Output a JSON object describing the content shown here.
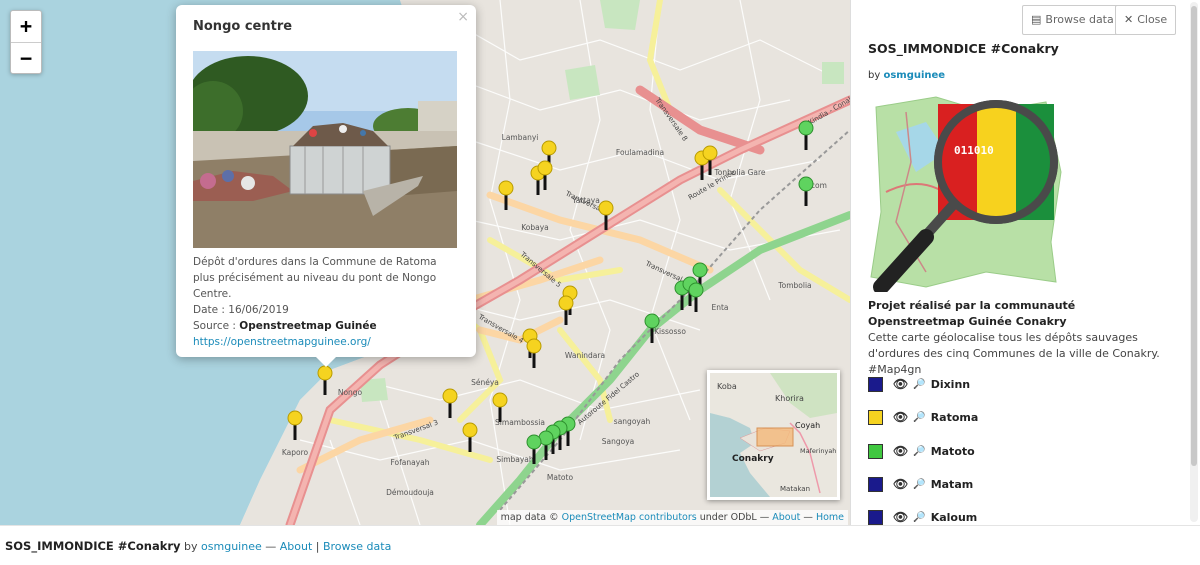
{
  "map": {
    "zoom_in": "+",
    "zoom_out": "−",
    "place_labels": [
      {
        "text": "Foulamadina"
      },
      {
        "text": "Yattaya"
      },
      {
        "text": "Kobaya"
      },
      {
        "text": "Tonbolia Gare"
      },
      {
        "text": "Tombolia"
      },
      {
        "text": "Cocom"
      },
      {
        "text": "Kissosso"
      },
      {
        "text": "Enta"
      },
      {
        "text": "Wanindara"
      },
      {
        "text": "Sénéya"
      },
      {
        "text": "Simbayah"
      },
      {
        "text": "Nongo"
      },
      {
        "text": "Simambossia"
      },
      {
        "text": "sangoyah"
      },
      {
        "text": "Sangoya"
      },
      {
        "text": "Kaporo"
      },
      {
        "text": "Fofanayah"
      },
      {
        "text": "Démoudouja"
      },
      {
        "text": "Matoto"
      },
      {
        "text": "Lambanyi"
      }
    ],
    "road_labels": [
      {
        "text": "Transversale 8"
      },
      {
        "text": "Transversale 7"
      },
      {
        "text": "Transversale 5"
      },
      {
        "text": "Transversale 4"
      },
      {
        "text": "Transversal 3"
      },
      {
        "text": "Autoroute Fidel Castro"
      },
      {
        "text": "Route le Prince"
      },
      {
        "text": "Kindia - Conakry"
      },
      {
        "text": "Transversal 6"
      }
    ],
    "minimap_labels": [
      {
        "text": "Koba"
      },
      {
        "text": "Khorira"
      },
      {
        "text": "Coyah"
      },
      {
        "text": "Conakry"
      },
      {
        "text": "Maferinyah"
      },
      {
        "text": "Matakan"
      }
    ],
    "attribution": {
      "prefix": "map data ©",
      "osm": "OpenStreetMap contributors",
      "license": "under ODbL",
      "sep1": "—",
      "about": "About",
      "sep2": "—",
      "home": "Home"
    },
    "colors": {
      "ratoma": "#f5d320",
      "matoto": "#5fd35f"
    }
  },
  "popup": {
    "close": "×",
    "title": "Nongo centre",
    "desc_1": "Dépôt d'ordures dans la Commune de Ratoma plus précisément au niveau du pont de Nongo Centre.",
    "date": "Date : 16/06/2019",
    "source_label": "Source :",
    "source_name": "Openstreetmap Guinée",
    "link": "https://openstreetmapguinee.org/"
  },
  "panel": {
    "browse_btn": "Browse data",
    "close_btn": "Close",
    "title": "SOS_IMMONDICE #Conakry",
    "by_label": "by",
    "author": "osmguinee",
    "logo_text": "011010",
    "desc_title": "Projet réalisé par la communauté Openstreetmap Guinée Conakry",
    "desc_body": "Cette carte géolocalise tous les dépôts sauvages d'ordures des cinq Communes de la ville de Conakry. #Map4gn",
    "layers": [
      {
        "name": "Dixinn",
        "color": "#1a1a8c"
      },
      {
        "name": "Ratoma",
        "color": "#f5d320"
      },
      {
        "name": "Matoto",
        "color": "#40c840"
      },
      {
        "name": "Matam",
        "color": "#1a1a8c"
      },
      {
        "name": "Kaloum",
        "color": "#1a1a8c"
      }
    ]
  },
  "footer": {
    "title": "SOS_IMMONDICE #Conakry",
    "by": "by",
    "author": "osmguinee",
    "sep": "—",
    "about": "About",
    "bar": "|",
    "browse": "Browse data"
  }
}
